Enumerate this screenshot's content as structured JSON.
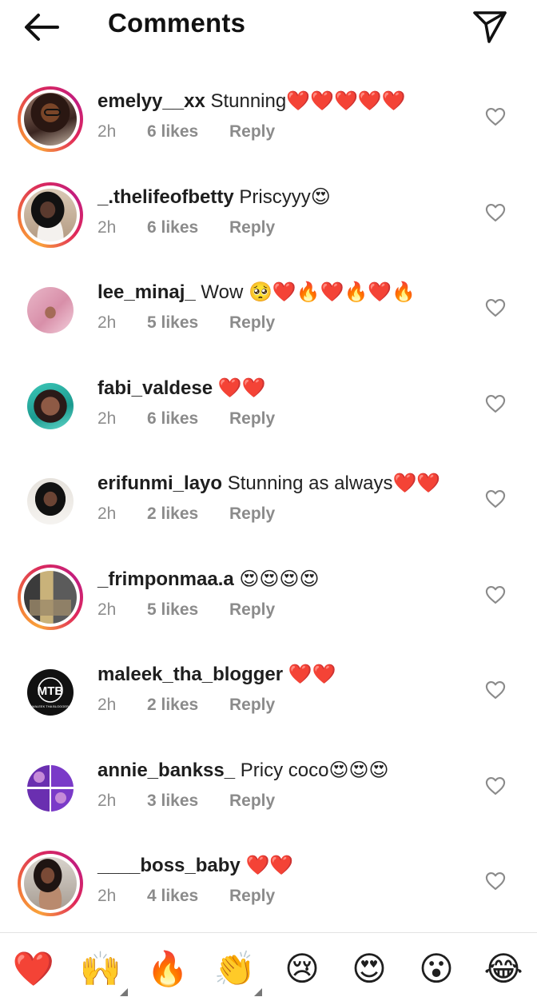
{
  "header": {
    "title": "Comments",
    "back_icon": "arrow-left-icon",
    "share_icon": "paper-plane-icon"
  },
  "comments": [
    {
      "username": "emelyy__xx",
      "text": " Stunning❤️❤️❤️❤️❤️",
      "time": "2h",
      "likes": "6 likes",
      "reply": "Reply",
      "story_ring": true
    },
    {
      "username": "_.thelifeofbetty",
      "text": " Priscyyy😍",
      "time": "2h",
      "likes": "6 likes",
      "reply": "Reply",
      "story_ring": true
    },
    {
      "username": "lee_minaj_",
      "text": " Wow 🥺❤️🔥❤️🔥❤️🔥",
      "time": "2h",
      "likes": "5 likes",
      "reply": "Reply",
      "story_ring": false
    },
    {
      "username": "fabi_valdese",
      "text": " ❤️❤️",
      "time": "2h",
      "likes": "6 likes",
      "reply": "Reply",
      "story_ring": false
    },
    {
      "username": "erifunmi_layo",
      "text": " Stunning as always❤️❤️",
      "time": "2h",
      "likes": "2 likes",
      "reply": "Reply",
      "story_ring": false
    },
    {
      "username": "_frimponmaa.a",
      "text": " 😍😍😍😍",
      "time": "2h",
      "likes": "5 likes",
      "reply": "Reply",
      "story_ring": true
    },
    {
      "username": "maleek_tha_blogger",
      "text": " ❤️❤️",
      "time": "2h",
      "likes": "2 likes",
      "reply": "Reply",
      "story_ring": false
    },
    {
      "username": "annie_bankss_",
      "text": " Pricy coco😍😍😍",
      "time": "2h",
      "likes": "3 likes",
      "reply": "Reply",
      "story_ring": false
    },
    {
      "username": "____boss_baby",
      "text": " ❤️❤️",
      "time": "2h",
      "likes": "4 likes",
      "reply": "Reply",
      "story_ring": true
    }
  ],
  "avatar_text": {
    "maleek_logo": "MTB",
    "maleek_caption": "MALEEK THA BLOGGER"
  },
  "emoji_bar": [
    {
      "emoji": "❤️",
      "name": "red-heart"
    },
    {
      "emoji": "🙌",
      "name": "raising-hands"
    },
    {
      "emoji": "🔥",
      "name": "fire"
    },
    {
      "emoji": "👏",
      "name": "clapping-hands"
    },
    {
      "emoji": "😢",
      "name": "crying-face"
    },
    {
      "emoji": "😍",
      "name": "heart-eyes"
    },
    {
      "emoji": "😮",
      "name": "open-mouth"
    },
    {
      "emoji": "😂",
      "name": "tears-of-joy"
    }
  ],
  "colors": {
    "story_ring_start": "#f9a23a",
    "story_ring_end": "#c21d7f",
    "meta_text": "#8b8b8b",
    "divider": "#e3e3e3"
  }
}
